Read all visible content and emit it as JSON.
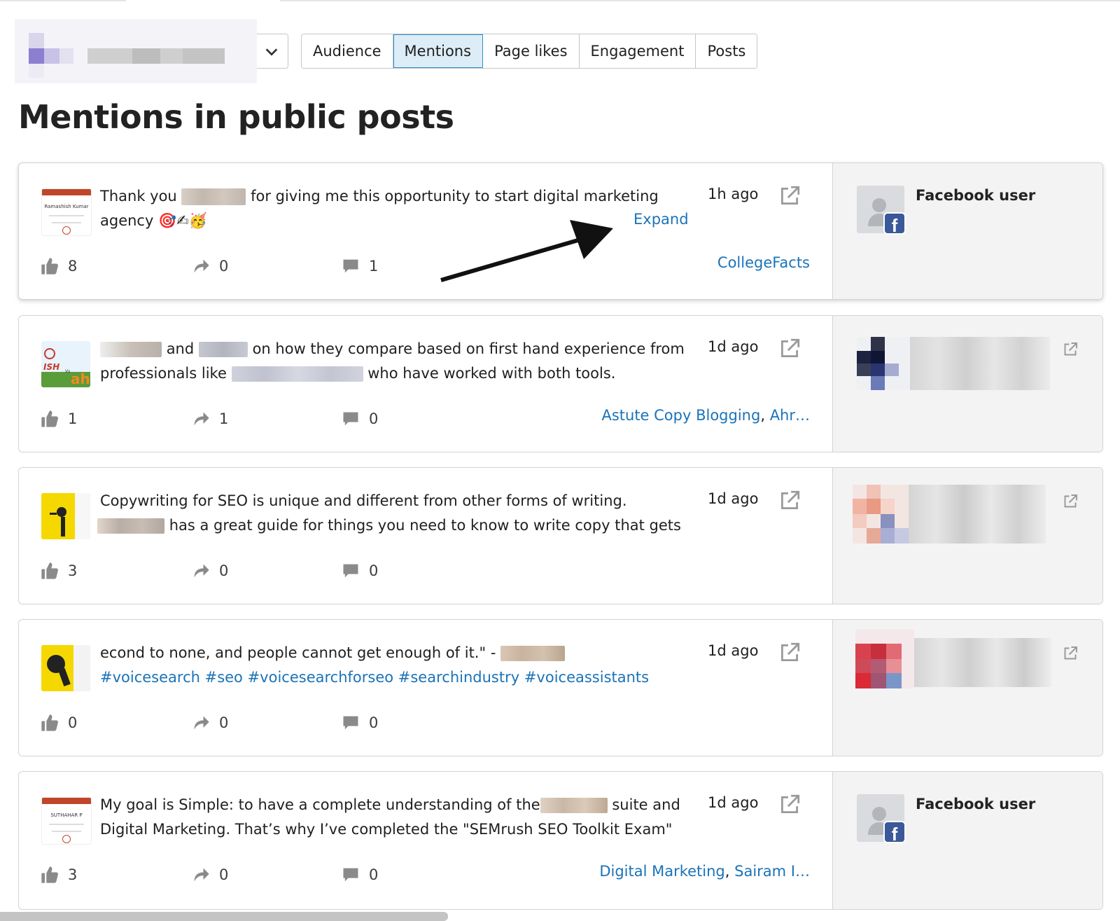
{
  "account_selector": {
    "chevron_icon": "chevron-down-icon"
  },
  "tabs": [
    {
      "label": "Audience",
      "active": false
    },
    {
      "label": "Mentions",
      "active": true
    },
    {
      "label": "Page likes",
      "active": false
    },
    {
      "label": "Engagement",
      "active": false
    },
    {
      "label": "Posts",
      "active": false
    }
  ],
  "page_title": "Mentions in public posts",
  "colors": {
    "link": "#1a73b8",
    "active_tab_bg": "#dcedf7",
    "facebook": "#3b5998"
  },
  "posts": [
    {
      "text_a": "Thank you ",
      "text_b": " for giving me this opportunity to start digital marketing",
      "text_c": "agency 🎯✍🥳",
      "time": "1h ago",
      "expand": "Expand",
      "likes": "8",
      "shares": "0",
      "comments": "1",
      "tags": [
        "CollegeFacts"
      ],
      "author": {
        "name": "Facebook user",
        "facebook_badge": "f"
      }
    },
    {
      "text_a": "and",
      "text_b": "on how they compare based on first hand experience from",
      "text_c": "professionals like",
      "text_d": "who have worked with both tools.",
      "time": "1d ago",
      "likes": "1",
      "shares": "1",
      "comments": "0",
      "tags": [
        "Astute Copy Blogging",
        "Ahr…"
      ]
    },
    {
      "text_a": "Copywriting for SEO is unique and different from other forms of writing.",
      "text_b": "has a great guide for things you need to know to write copy that gets",
      "time": "1d ago",
      "likes": "3",
      "shares": "0",
      "comments": "0"
    },
    {
      "text_a": "econd to none, and people cannot get enough of it.\" -",
      "hashtags": "#voicesearch #seo #voicesearchforseo #searchindustry #voiceassistants",
      "time": "1d ago",
      "likes": "0",
      "shares": "0",
      "comments": "0"
    },
    {
      "text_a": "My goal is Simple: to have a complete understanding of the",
      "text_b": "suite and",
      "text_c": "Digital Marketing. That’s why I’ve completed the \"SEMrush SEO Toolkit Exam\"",
      "time": "1d ago",
      "likes": "3",
      "shares": "0",
      "comments": "0",
      "tags": [
        "Digital Marketing",
        "Sairam I…"
      ],
      "author": {
        "name": "Facebook user",
        "facebook_badge": "f"
      }
    }
  ],
  "thumbnails": {
    "post1": {
      "banner": "Ramashish Kumar"
    },
    "post2": {
      "label_top": "ISH",
      "label_vs": "Vs",
      "label_bottom": "ah"
    },
    "post5": {
      "banner": "SUTHAHAR P"
    }
  }
}
